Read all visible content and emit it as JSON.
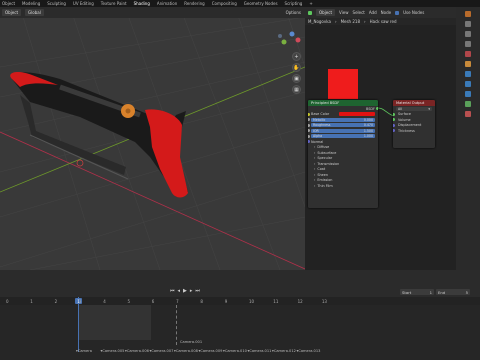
{
  "topbar": {
    "menus": [
      "Object",
      "Modeling",
      "Sculpting",
      "UV Editing",
      "Texture Paint",
      "Shading",
      "Animation",
      "Rendering",
      "Compositing",
      "Geometry Nodes",
      "Scripting",
      "+"
    ],
    "active_index": 5
  },
  "viewport": {
    "header": {
      "mode": "Object",
      "orientation": "Global",
      "options": "Options"
    }
  },
  "node_editor": {
    "header": {
      "mode": "Object",
      "menus": [
        "View",
        "Select",
        "Add",
        "Node"
      ],
      "use_nodes_label": "Use Nodes",
      "slot": "Slot 1"
    },
    "breadcrumb": [
      "M_Nogovka",
      "Mesh 218",
      "Hack saw red"
    ],
    "principled": {
      "title": "Principled BSDF",
      "bsdf_label": "BSDF",
      "base_color_label": "Base Color",
      "inputs": [
        {
          "label": "Metallic",
          "value": "0.000"
        },
        {
          "label": "Roughness",
          "value": "0.470"
        },
        {
          "label": "IOR",
          "value": "1.500"
        },
        {
          "label": "Alpha",
          "value": "1.000"
        }
      ],
      "normal_label": "Normal",
      "sections": [
        "Diffuse",
        "Subsurface",
        "Specular",
        "Transmission",
        "Coat",
        "Sheen",
        "Emission",
        "Thin Film"
      ]
    },
    "material_output": {
      "title": "Material Output",
      "target": "All",
      "sockets": [
        "Surface",
        "Volume",
        "Displacement",
        "Thickness"
      ]
    }
  },
  "timeline": {
    "frame_labels": [
      "0",
      "1",
      "2",
      "3",
      "4",
      "5",
      "6",
      "7",
      "8",
      "9",
      "10",
      "11",
      "12",
      "13"
    ],
    "current_frame": "1",
    "start_label": "Start",
    "start_value": "1",
    "end_label": "End",
    "end_value": "5",
    "markers": [
      "Camera",
      "Camera.005",
      "Camera.006",
      "Camera.007",
      "Camera.008",
      "Camera.009",
      "Camera.010",
      "Camera.011",
      "Camera.012",
      "Camera.013"
    ],
    "camera_label_mid": "Camera.001"
  },
  "colors": {
    "accent": "#4772b3",
    "base_color": "#e01212",
    "node_header_principled": "#1e6430",
    "node_header_output": "#7a2424",
    "saw_red": "#d41a1a"
  }
}
